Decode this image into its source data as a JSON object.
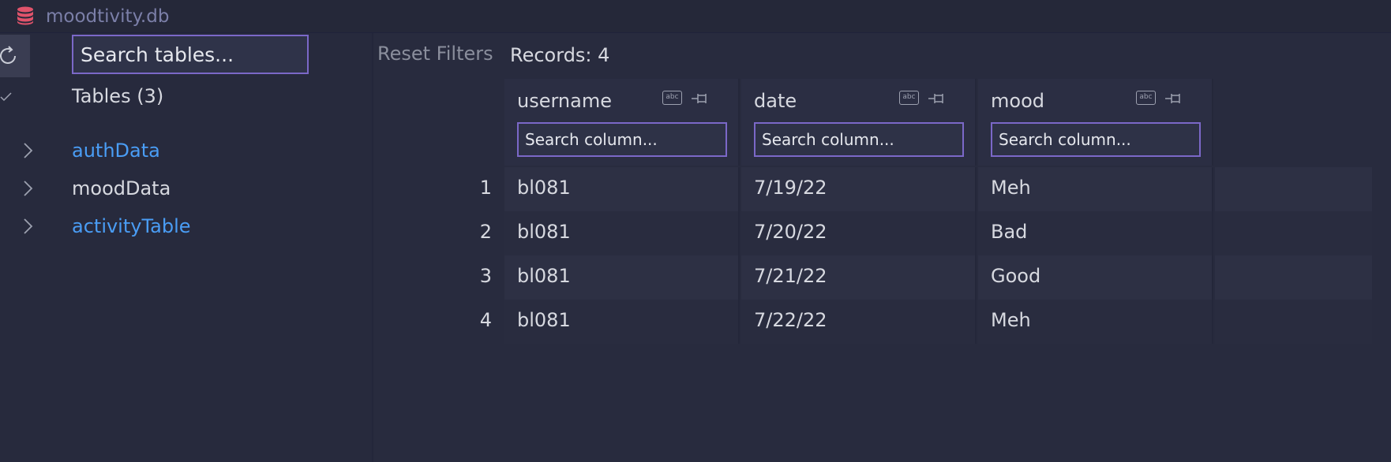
{
  "window": {
    "title": "moodtivity.db"
  },
  "sidebar": {
    "search_placeholder": "Search tables...",
    "tables_header": "Tables (3)",
    "tables": [
      {
        "name": "authData",
        "style": "link"
      },
      {
        "name": "moodData",
        "style": "plain"
      },
      {
        "name": "activityTable",
        "style": "link"
      }
    ]
  },
  "toolbar": {
    "reset_label": "Reset Filters",
    "records_label": "Records: 4"
  },
  "grid": {
    "columns": [
      {
        "name": "username",
        "type_badge": "abc",
        "search_placeholder": "Search column..."
      },
      {
        "name": "date",
        "type_badge": "abc",
        "search_placeholder": "Search column..."
      },
      {
        "name": "mood",
        "type_badge": "abc",
        "search_placeholder": "Search column..."
      }
    ],
    "rows": [
      {
        "num": "1",
        "cells": [
          "bl081",
          "7/19/22",
          "Meh"
        ]
      },
      {
        "num": "2",
        "cells": [
          "bl081",
          "7/20/22",
          "Bad"
        ]
      },
      {
        "num": "3",
        "cells": [
          "bl081",
          "7/21/22",
          "Good"
        ]
      },
      {
        "num": "4",
        "cells": [
          "bl081",
          "7/22/22",
          "Meh"
        ]
      }
    ]
  },
  "colors": {
    "accent": "#7b68c8",
    "link": "#4a9df5",
    "db_icon": "#e0536b"
  },
  "icons": [
    "database-icon",
    "refresh-icon",
    "check-icon",
    "chevron-right-icon",
    "type-abc-icon",
    "pin-icon"
  ]
}
